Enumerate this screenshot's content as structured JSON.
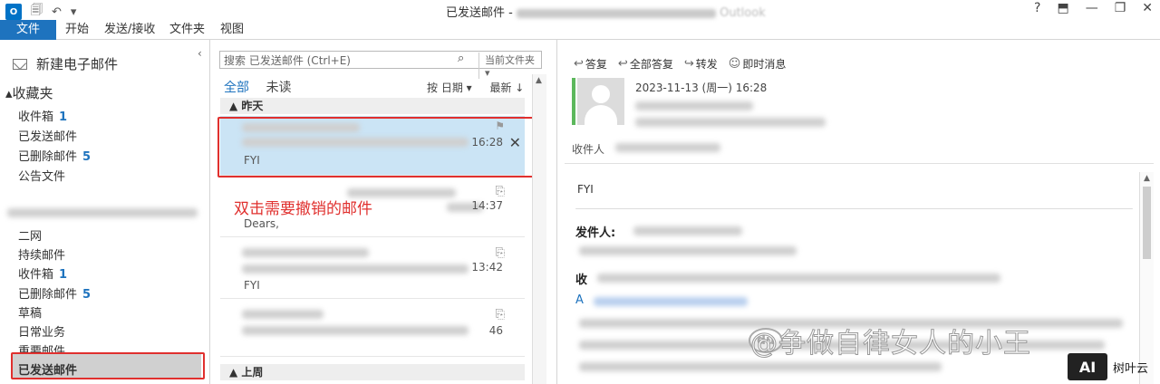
{
  "window": {
    "title": "已发送邮件 -",
    "title_suffix": "Outlook",
    "controls": [
      "?",
      "⬒",
      "—",
      "❐",
      "✕"
    ]
  },
  "ribbon": {
    "tabs": [
      "文件",
      "开始",
      "发送/接收",
      "文件夹",
      "视图"
    ]
  },
  "left_pane": {
    "new_mail": "新建电子邮件",
    "favorites_header": "收藏夹",
    "favorites": [
      {
        "label": "收件箱",
        "count": "1"
      },
      {
        "label": "已发送邮件",
        "count": ""
      },
      {
        "label": "已删除邮件",
        "count": "5"
      },
      {
        "label": "公告文件",
        "count": ""
      }
    ],
    "folders": [
      {
        "label": "二网",
        "count": ""
      },
      {
        "label": "持续邮件",
        "count": ""
      },
      {
        "label": "收件箱",
        "count": "1"
      },
      {
        "label": "已删除邮件",
        "count": "5"
      },
      {
        "label": "草稿",
        "count": ""
      },
      {
        "label": "日常业务",
        "count": ""
      },
      {
        "label": "重要邮件",
        "count": ""
      },
      {
        "label": "已发送邮件",
        "count": ""
      }
    ]
  },
  "message_list": {
    "search_placeholder": "搜索 已发送邮件 (Ctrl+E)",
    "search_scope": "当前文件夹",
    "filter_all": "全部",
    "filter_unread": "未读",
    "sort_by": "按 日期 ▾",
    "sort_order": "最新 ↓",
    "group_yesterday": "▲ 昨天",
    "group_last_week": "▲ 上周",
    "mails": [
      {
        "time": "16:28",
        "snippet": "FYI"
      },
      {
        "time": "14:37",
        "snippet": "Dears,"
      },
      {
        "time": "13:42",
        "snippet": "FYI"
      },
      {
        "time": "46",
        "snippet": ""
      }
    ],
    "annotation": "双击需要撤销的邮件"
  },
  "reading_pane": {
    "actions": [
      "答复",
      "全部答复",
      "转发",
      "即时消息"
    ],
    "date": "2023-11-13 (周一) 16:28",
    "to_label": "收件人",
    "body_fyi": "FYI",
    "from_label": "发件人:",
    "recv_label": "收",
    "link_prefix": "A"
  },
  "watermark": "@争做自律女人的小王",
  "watermark_badge": "du",
  "logo": {
    "badge": "AI",
    "text": "树叶云"
  },
  "colors": {
    "accent": "#1e73be",
    "highlight": "#e0302e",
    "selected_row": "#cbe4f5"
  }
}
